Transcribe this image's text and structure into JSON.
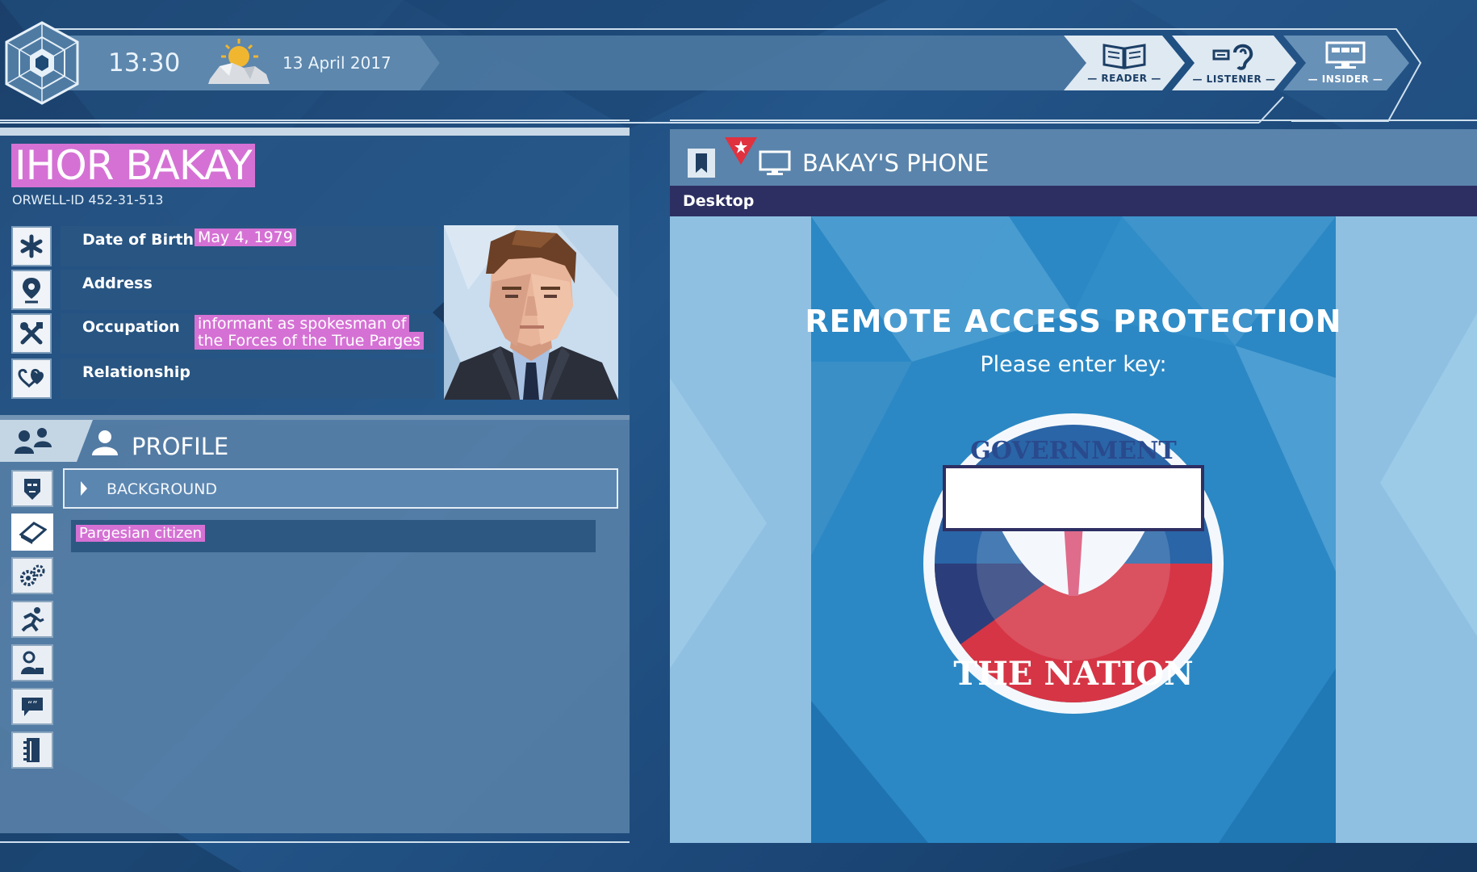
{
  "topbar": {
    "time": "13:30",
    "date": "13 April 2017",
    "modes": [
      {
        "label": "— READER —",
        "icon": "book-icon"
      },
      {
        "label": "— LISTENER —",
        "icon": "ear-icon"
      },
      {
        "label": "— INSIDER —",
        "icon": "computer-icon"
      }
    ]
  },
  "profile": {
    "name": "IHOR BAKAY",
    "orwell_id": "ORWELL-ID  452-31-513",
    "attributes": [
      {
        "label": "Date of Birth",
        "value": "May 4, 1979",
        "icon": "asterisk-icon"
      },
      {
        "label": "Address",
        "value": "",
        "icon": "location-pin-icon"
      },
      {
        "label": "Occupation",
        "value_line1": "informant as spokesman of",
        "value_line2": "the Forces of the True Parges",
        "icon": "tools-icon"
      },
      {
        "label": "Relationship",
        "value": "",
        "icon": "hearts-icon"
      }
    ],
    "section_title": "PROFILE",
    "category": "BACKGROUND",
    "entries": [
      "Pargesian citizen"
    ],
    "sidebar_icons": [
      "face-icon",
      "book-icon",
      "gears-icon",
      "running-person-icon",
      "person-info-icon",
      "speech-bubble-icon",
      "notebook-icon"
    ]
  },
  "phone": {
    "title": "BAKAY'S PHONE",
    "path": "Desktop",
    "heading": "REMOTE ACCESS PROTECTION",
    "prompt": "Please enter key:",
    "key_value": "",
    "seal_top_text": "GOVERNMENT",
    "seal_bottom_text": "THE NATION"
  },
  "colors": {
    "highlight": "#d571d4",
    "panel_dark": "#285582",
    "accent_red": "#e0313f"
  }
}
